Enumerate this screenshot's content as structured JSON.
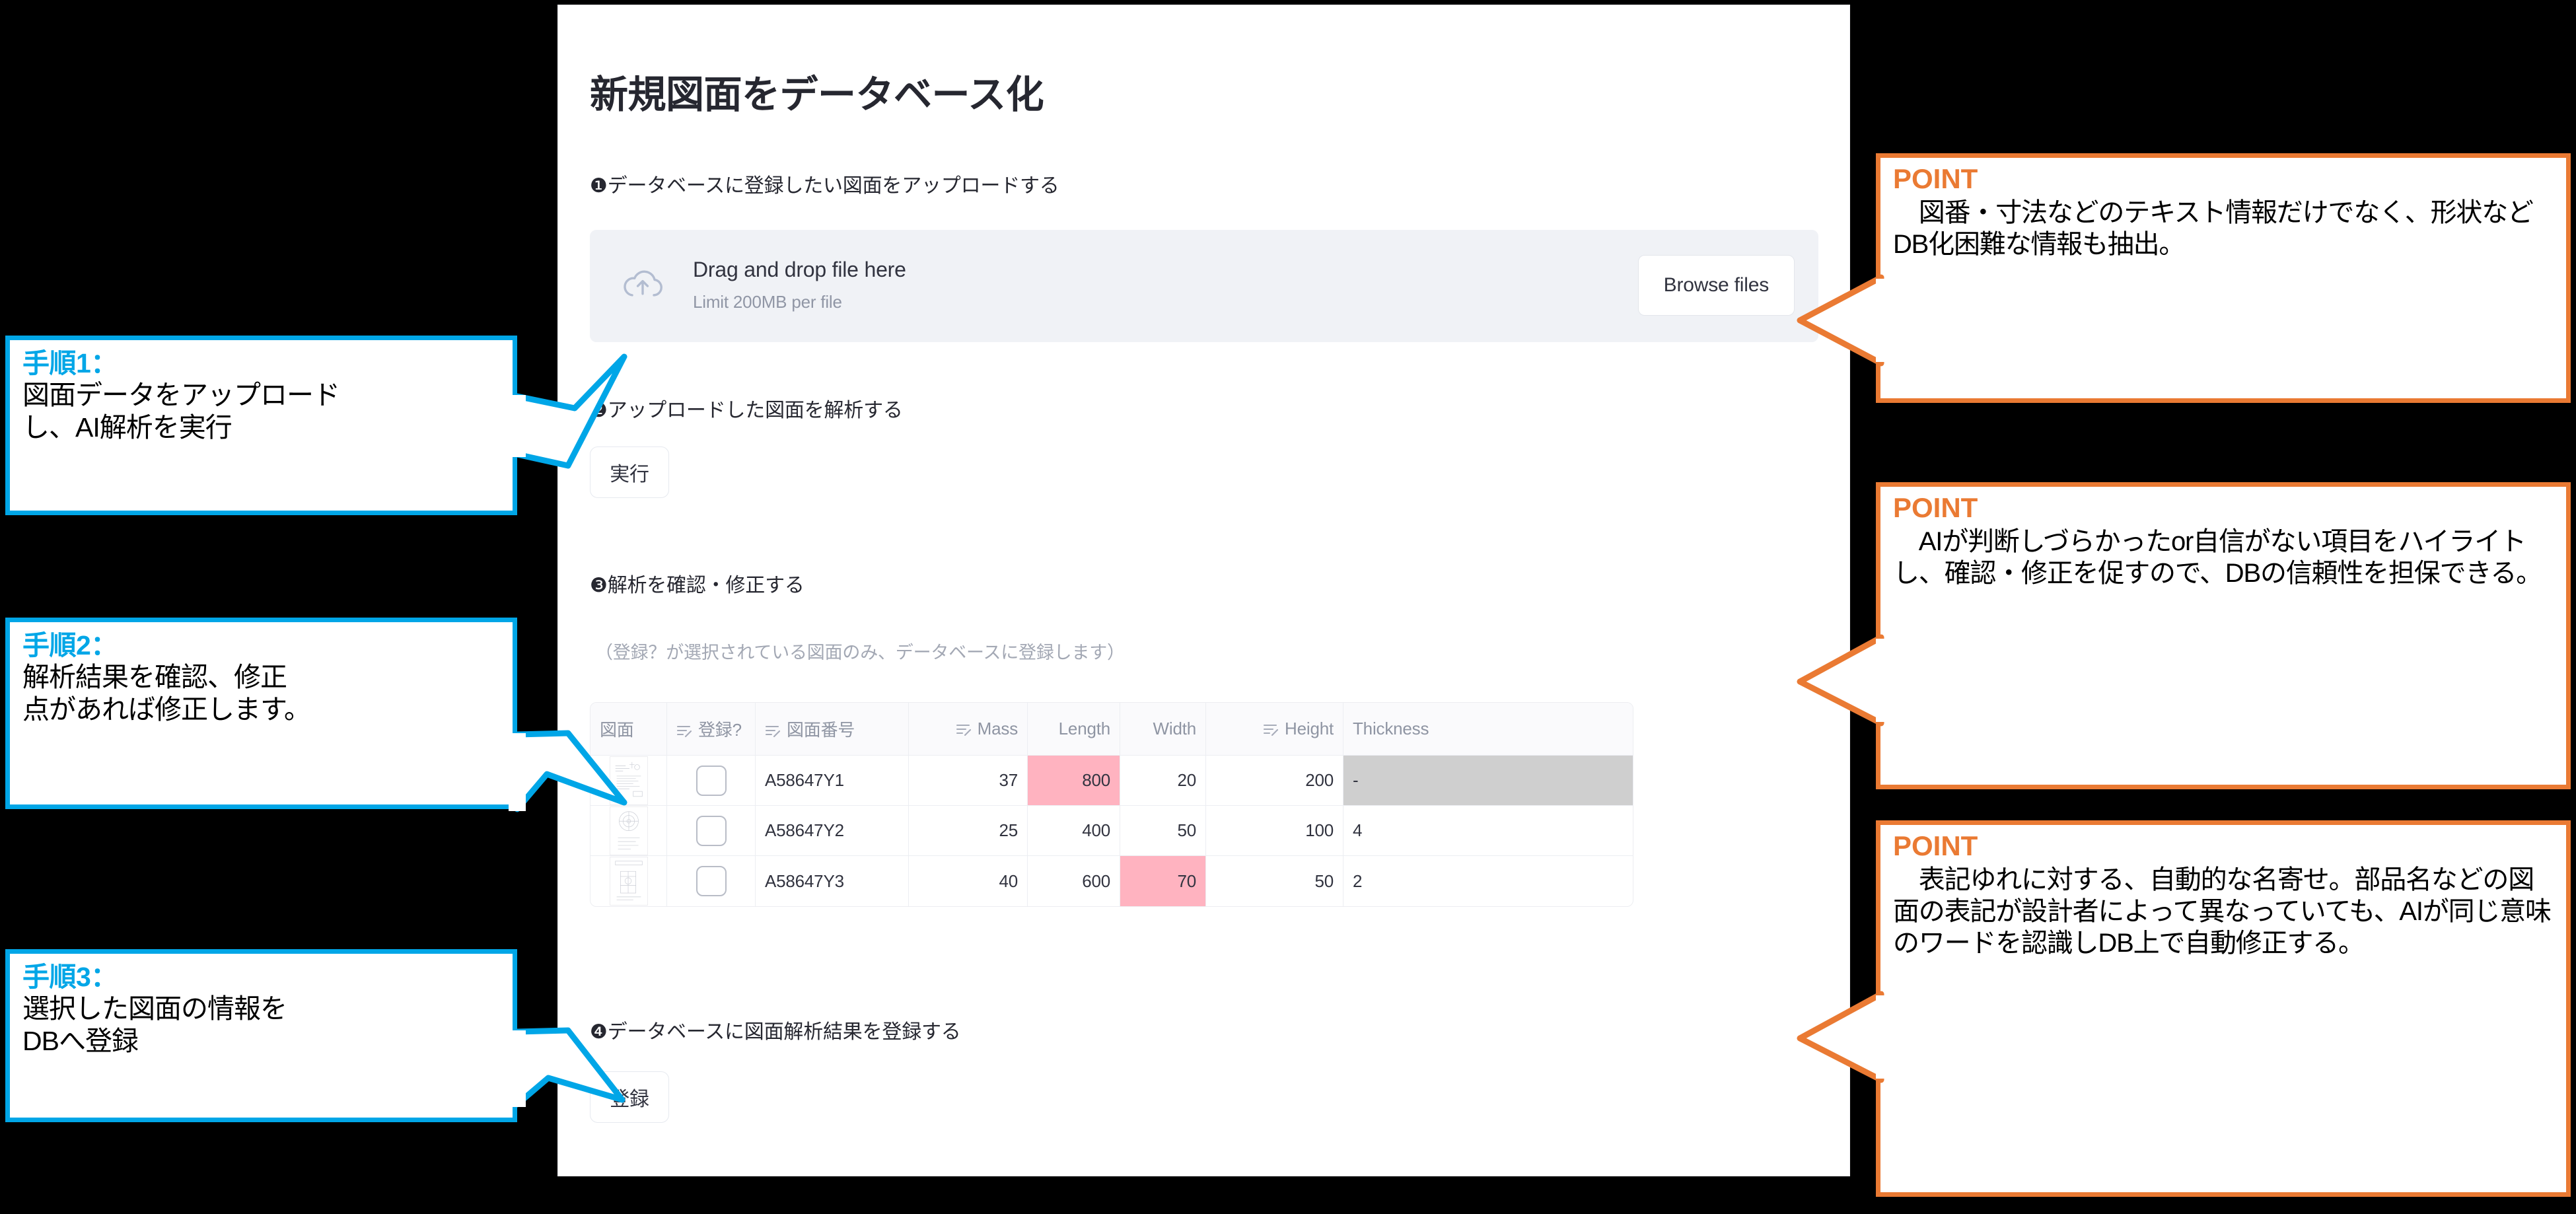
{
  "app": {
    "title": "新規図面をデータベース化",
    "steps": {
      "step1_label": "❶データベースに登録したい図面をアップロードする",
      "step2_label": "❷アップロードした図面を解析する",
      "step3_label": "❸解析を確認・修正する",
      "step3_note": "（登録？が選択されている図面のみ、データベースに登録します）",
      "step4_label": "❹データベースに図面解析結果を登録する"
    },
    "dropzone": {
      "icon": "cloud-upload-icon",
      "main_text": "Drag and drop file here",
      "limit_text": "Limit 200MB per file",
      "browse_label": "Browse files"
    },
    "buttons": {
      "run_label": "実行",
      "register_label": "登録"
    },
    "table": {
      "columns": [
        {
          "label": "図面",
          "filter": false,
          "numeric": false
        },
        {
          "label": "登録?",
          "filter": true,
          "numeric": false
        },
        {
          "label": "図面番号",
          "filter": true,
          "numeric": false
        },
        {
          "label": "Mass",
          "filter": true,
          "numeric": true
        },
        {
          "label": "Length",
          "filter": false,
          "numeric": true
        },
        {
          "label": "Width",
          "filter": false,
          "numeric": true
        },
        {
          "label": "Height",
          "filter": true,
          "numeric": true
        },
        {
          "label": "Thickness",
          "filter": false,
          "numeric": false
        }
      ],
      "rows": [
        {
          "thumbnail": "drawing-thumbnail-1",
          "checked": false,
          "drawing_no": "A58647Y1",
          "mass": "37",
          "length": "800",
          "width": "20",
          "height": "200",
          "thickness": "-",
          "highlight": [
            "length"
          ],
          "disabled": [
            "thickness"
          ]
        },
        {
          "thumbnail": "drawing-thumbnail-2",
          "checked": false,
          "drawing_no": "A58647Y2",
          "mass": "25",
          "length": "400",
          "width": "50",
          "height": "100",
          "thickness": "4",
          "highlight": [],
          "disabled": []
        },
        {
          "thumbnail": "drawing-thumbnail-3",
          "checked": false,
          "drawing_no": "A58647Y3",
          "mass": "40",
          "length": "600",
          "width": "70",
          "height": "50",
          "thickness": "2",
          "highlight": [
            "width"
          ],
          "disabled": []
        }
      ]
    }
  },
  "steps_callouts": [
    {
      "title": "手順1：",
      "body": "図面データをアップロード\nし、AI解析を実行"
    },
    {
      "title": "手順2：",
      "body": "解析結果を確認、修正\n点があれば修正します。"
    },
    {
      "title": "手順3：",
      "body": "選択した図面の情報を\nDBへ登録"
    }
  ],
  "point_callouts": [
    {
      "title": "POINT",
      "body": "　図番・寸法などのテキスト情報だけでなく、形状などDB化困難な情報も抽出。"
    },
    {
      "title": "POINT",
      "body": "　AIが判断しづらかったor自信がない項目をハイライトし、確認・修正を促すので、DBの信頼性を担保できる。"
    },
    {
      "title": "POINT",
      "body": "　表記ゆれに対する、自動的な名寄せ。部品名などの図面の表記が設計者によって異なっていても、AIが同じ意味のワードを認識しDB上で自動修正する。"
    }
  ],
  "colors": {
    "accent_cyan": "#00a6e7",
    "accent_orange": "#ea7a33",
    "highlight_pink": "#ffb3c0",
    "highlight_red_text": "#ff2b2b",
    "disabled_gray": "#cfcfcf",
    "panel_bg": "#ffffff",
    "page_bg": "#000000"
  }
}
